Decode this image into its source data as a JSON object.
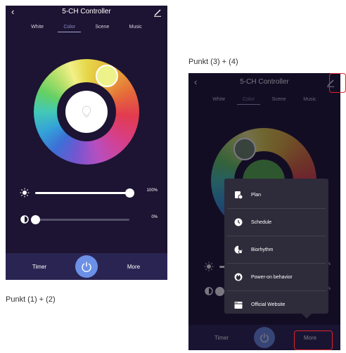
{
  "controller_title": "5-CH Controller",
  "tabs": [
    "White",
    "Color",
    "Scene",
    "Music"
  ],
  "active_tab": "Color",
  "brightness_value": "100%",
  "brightness_level": 1.0,
  "contrast_value": "0%",
  "contrast_level": 0.0,
  "bottom_bar": {
    "timer": "Timer",
    "more": "More"
  },
  "menu": [
    {
      "label": "Plan",
      "icon": "plan-icon"
    },
    {
      "label": "Schedule",
      "icon": "clock-icon"
    },
    {
      "label": "Biorhythm",
      "icon": "biorhythm-icon"
    },
    {
      "label": "Power-on behavior",
      "icon": "power-plug-icon"
    },
    {
      "label": "Official Website",
      "icon": "website-icon"
    }
  ],
  "captions": {
    "left": "Punkt (1) + (2)",
    "right": "Punkt (3) + (4)"
  },
  "colors": {
    "background": "#1c1432",
    "bottom_bar": "#2a2452",
    "power_button": "#6c90e6",
    "highlight": "#e0242a",
    "menu": "#2e2b3a"
  }
}
